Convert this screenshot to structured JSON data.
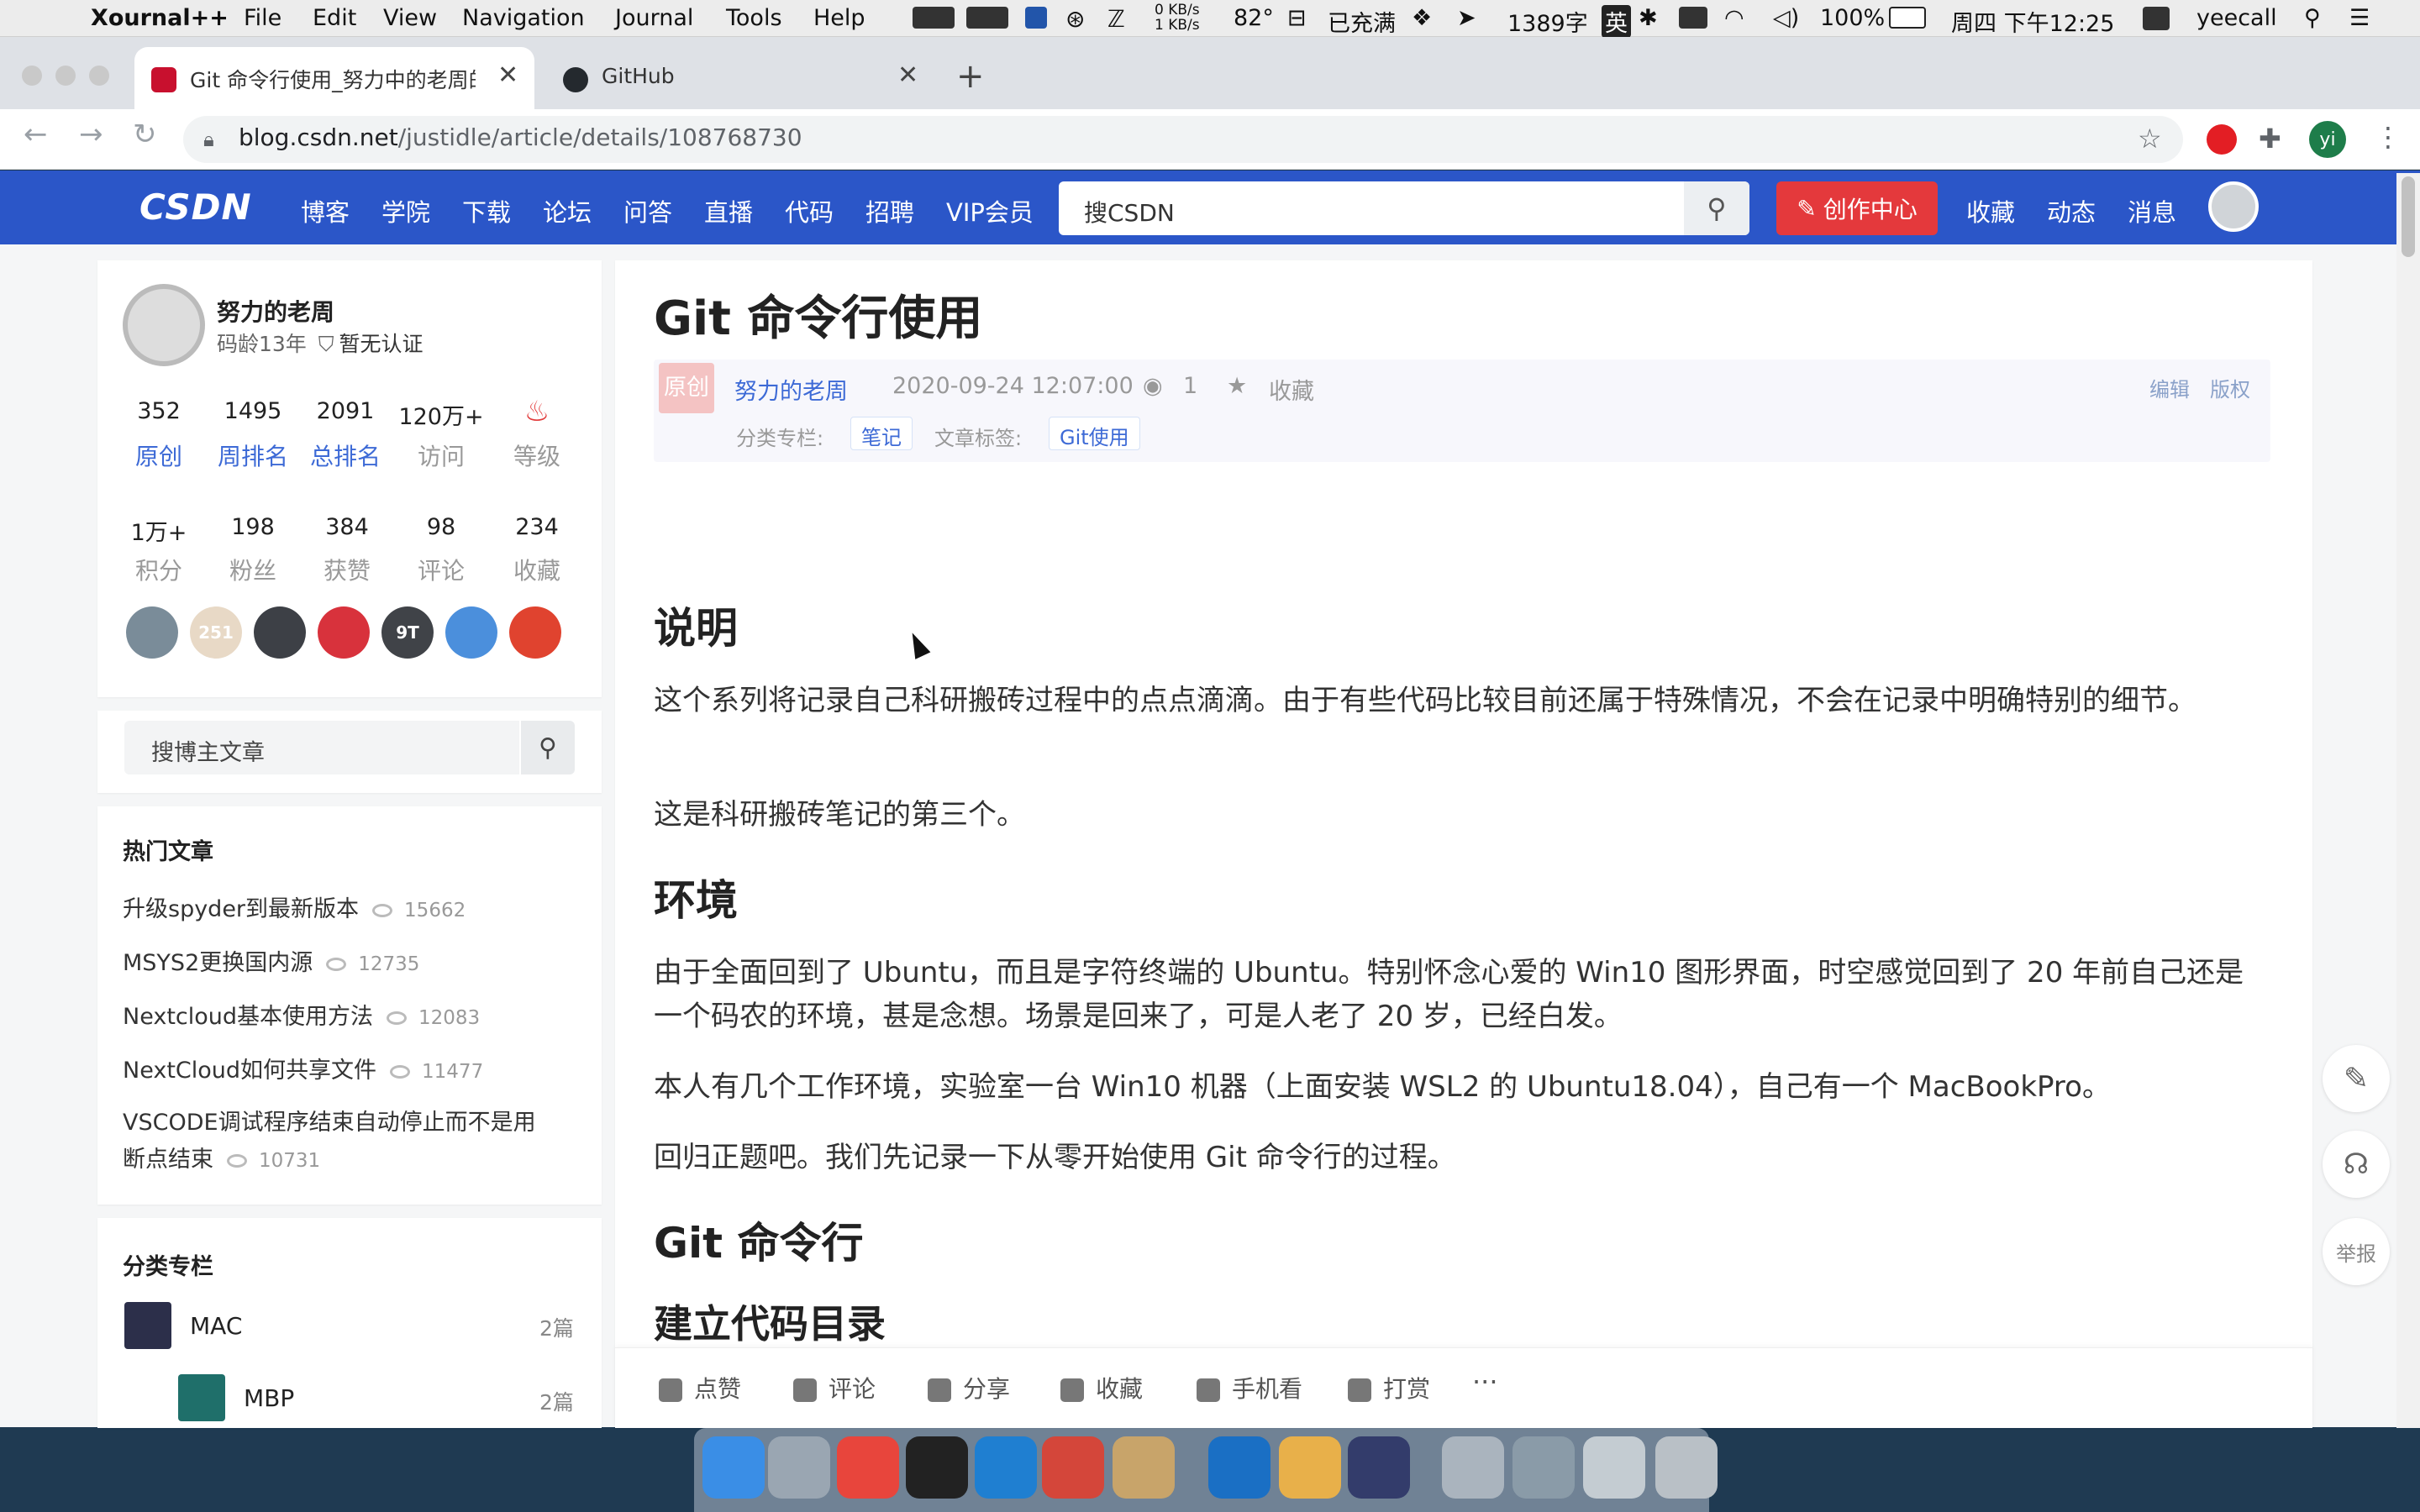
{
  "menubar": {
    "app": "Xournal++",
    "menus": [
      "File",
      "Edit",
      "View",
      "Navigation",
      "Journal",
      "Tools",
      "Help"
    ],
    "net_up": "0 KB/s",
    "net_down": "1 KB/s",
    "temp": "82°",
    "charge": "已充满",
    "wordcount": "1389字",
    "ime": "英",
    "battery": "100%",
    "datetime": "周四 下午12:25",
    "user": "yeecall"
  },
  "browser": {
    "tabs": [
      {
        "title": "Git 命令行使用_努力中的老周的博客"
      },
      {
        "title": "GitHub"
      }
    ],
    "url_host": "blog.csdn.net",
    "url_path": "/justidle/article/details/108768730",
    "profile_initial": "yi"
  },
  "csdn": {
    "logo": "CSDN",
    "nav": [
      "博客",
      "学院",
      "下载",
      "论坛",
      "问答",
      "直播",
      "代码",
      "招聘",
      "VIP会员"
    ],
    "search_placeholder": "搜CSDN",
    "create": "创作中心",
    "right_nav": [
      "收藏",
      "动态",
      "消息"
    ]
  },
  "profile": {
    "name": "努力的老周",
    "age": "码龄13年",
    "cert": "暂无认证",
    "stats1": [
      {
        "value": "352",
        "label": "原创"
      },
      {
        "value": "1495",
        "label": "周排名"
      },
      {
        "value": "2091",
        "label": "总排名"
      },
      {
        "value": "120万+",
        "label": "访问"
      },
      {
        "value": "",
        "label": "等级"
      }
    ],
    "stats2": [
      {
        "value": "1万+",
        "label": "积分"
      },
      {
        "value": "198",
        "label": "粉丝"
      },
      {
        "value": "384",
        "label": "获赞"
      },
      {
        "value": "98",
        "label": "评论"
      },
      {
        "value": "234",
        "label": "收藏"
      }
    ],
    "badge_colors": [
      "#7a8c99",
      "#e8d9c6",
      "#3d4046",
      "#d8323c",
      "#404348",
      "#4b8fdc",
      "#e0432f"
    ],
    "badge_texts": [
      "",
      "251",
      "",
      "",
      "9T",
      "",
      ""
    ]
  },
  "blogsearch": {
    "placeholder": "搜博主文章"
  },
  "hot": {
    "title": "热门文章",
    "items": [
      {
        "title": "升级spyder到最新版本",
        "views": "15662"
      },
      {
        "title": "MSYS2更换国内源",
        "views": "12735"
      },
      {
        "title": "Nextcloud基本使用方法",
        "views": "12083"
      },
      {
        "title": "NextCloud如何共享文件",
        "views": "11477"
      },
      {
        "title": "VSCODE调试程序结束自动停止而不是用",
        "title2": "断点结束",
        "views": "10731"
      }
    ]
  },
  "columns": {
    "title": "分类专栏",
    "items": [
      {
        "name": "MAC",
        "count": "2篇"
      },
      {
        "name": "MBP",
        "count": "2篇"
      }
    ]
  },
  "article": {
    "title": "Git 命令行使用",
    "badge": "原创",
    "author": "努力的老周",
    "date": "2020-09-24 12:07:00",
    "views": "1",
    "fav": "收藏",
    "edit": "编辑",
    "copyright": "版权",
    "column_label": "分类专栏:",
    "column_tag": "笔记",
    "tag_label": "文章标签:",
    "tag": "Git使用",
    "h_intro": "说明",
    "p1": "这个系列将记录自己科研搬砖过程中的点点滴滴。由于有些代码比较目前还属于特殊情况，不会在记录中明确特别的细节。",
    "p2": "这是科研搬砖笔记的第三个。",
    "h_env": "环境",
    "p3": "由于全面回到了 Ubuntu，而且是字符终端的 Ubuntu。特别怀念心爱的 Win10 图形界面，时空感觉回到了 20 年前自己还是一个码农的环境，甚是念想。场景是回来了，可是人老了 20 岁，已经白发。",
    "p4": "本人有几个工作环境，实验室一台 Win10 机器（上面安装 WSL2 的 Ubuntu18.04），自己有一个 MacBookPro。",
    "p5": "回归正题吧。我们先记录一下从零开始使用 Git 命令行的过程。",
    "h_git": "Git 命令行",
    "h_dir": "建立代码目录"
  },
  "bottombar": [
    "点赞",
    "评论",
    "分享",
    "收藏",
    "手机看",
    "打赏",
    "···"
  ],
  "float": {
    "report": "举报"
  },
  "dock_colors": [
    "#3a8ee6",
    "#9aa6b2",
    "#e8453c",
    "#222222",
    "#1f7fd1",
    "#d4463a",
    "#c8a46a",
    "#1a6fc4",
    "#e8b04a",
    "#333c6b",
    "#aab4be",
    "#8a9ba8",
    "#c4ccd2",
    "#b9c0c6"
  ]
}
